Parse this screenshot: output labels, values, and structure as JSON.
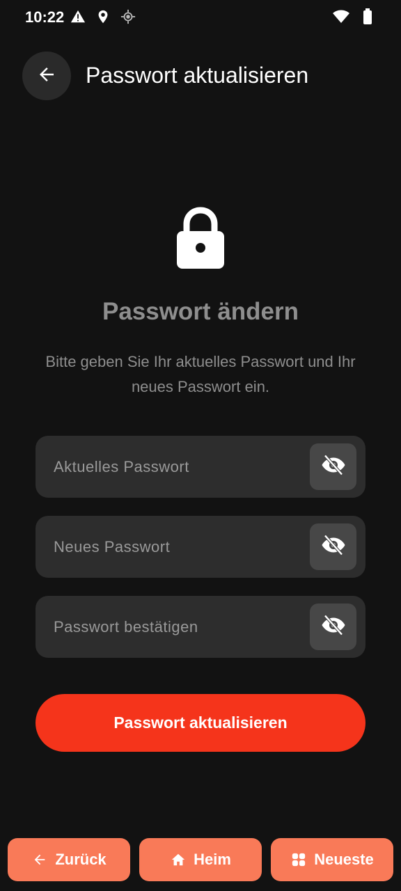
{
  "status_bar": {
    "time": "10:22",
    "left_icons": [
      "warning-icon",
      "location-pin-icon",
      "gps-icon"
    ],
    "right_icons": [
      "wifi-icon",
      "battery-icon"
    ]
  },
  "header": {
    "title": "Passwort aktualisieren",
    "back_icon": "arrow-left-icon"
  },
  "main": {
    "lock_icon": "lock-icon",
    "title": "Passwort ändern",
    "description": "Bitte geben Sie Ihr aktuelles Passwort und Ihr neues Passwort ein.",
    "fields": [
      {
        "placeholder": "Aktuelles Passwort",
        "value": "",
        "toggle_icon": "eye-off-icon"
      },
      {
        "placeholder": "Neues Passwort",
        "value": "",
        "toggle_icon": "eye-off-icon"
      },
      {
        "placeholder": "Passwort bestätigen",
        "value": "",
        "toggle_icon": "eye-off-icon"
      }
    ],
    "submit_label": "Passwort aktualisieren"
  },
  "bottom_nav": {
    "items": [
      {
        "label": "Zurück",
        "icon": "arrow-left-icon"
      },
      {
        "label": "Heim",
        "icon": "home-icon"
      },
      {
        "label": "Neueste",
        "icon": "grid-icon"
      }
    ]
  },
  "colors": {
    "background": "#121212",
    "field": "#2d2d2d",
    "accent": "#f5341b",
    "nav_button": "#f97a58",
    "muted_text": "#8e8e8e"
  }
}
